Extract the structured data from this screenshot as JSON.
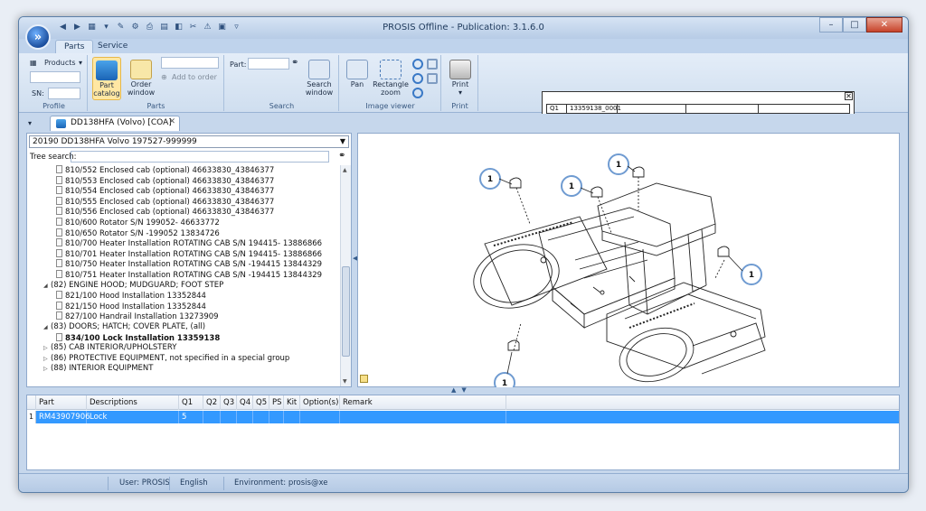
{
  "window": {
    "title": "PROSIS Offline - Publication: 3.1.6.0",
    "minimize": "–",
    "maximize": "□",
    "close": "✕"
  },
  "ribbon": {
    "tabs": [
      "Parts",
      "Service"
    ],
    "groups": {
      "profile": {
        "label": "Profile",
        "products": "Products",
        "sn_label": "SN:"
      },
      "parts": {
        "label": "Parts",
        "part_catalog": "Part catalog",
        "order_window": "Order window",
        "add_to_order": "Add to order"
      },
      "search": {
        "label": "Search",
        "part_label": "Part:",
        "search_window": "Search window"
      },
      "image_viewer": {
        "label": "Image viewer",
        "pan": "Pan",
        "rectangle_zoom": "Rectangle zoom"
      },
      "print": {
        "label": "Print",
        "print": "Print"
      }
    }
  },
  "pn_panel": {
    "col1": "Q1",
    "col2": "13359138_0001"
  },
  "doc_tab": {
    "label": "DD138HFA (Volvo) [COA]",
    "close": "✕"
  },
  "left_panel": {
    "model_select": "20190 DD138HFA Volvo 197527-999999",
    "tree_search_label": "Tree search:",
    "tree": [
      {
        "text": "810/552 Enclosed cab (optional) 46633830_43846377",
        "kind": "doc",
        "indent": 3
      },
      {
        "text": "810/553 Enclosed cab (optional) 46633830_43846377",
        "kind": "doc",
        "indent": 3
      },
      {
        "text": "810/554 Enclosed cab (optional) 46633830_43846377",
        "kind": "doc",
        "indent": 3
      },
      {
        "text": "810/555 Enclosed cab (optional) 46633830_43846377",
        "kind": "doc",
        "indent": 3
      },
      {
        "text": "810/556 Enclosed cab (optional) 46633830_43846377",
        "kind": "doc",
        "indent": 3
      },
      {
        "text": "810/600 Rotator S/N 199052- 46633772",
        "kind": "doc",
        "indent": 3
      },
      {
        "text": "810/650 Rotator S/N -199052 13834726",
        "kind": "doc",
        "indent": 3
      },
      {
        "text": "810/700 Heater Installation ROTATING CAB S/N 194415- 13886866",
        "kind": "doc",
        "indent": 3
      },
      {
        "text": "810/701 Heater Installation ROTATING CAB S/N 194415- 13886866",
        "kind": "doc",
        "indent": 3
      },
      {
        "text": "810/750 Heater Installation ROTATING CAB S/N -194415 13844329",
        "kind": "doc",
        "indent": 3
      },
      {
        "text": "810/751 Heater Installation ROTATING CAB S/N -194415 13844329",
        "kind": "doc",
        "indent": 3
      },
      {
        "text": "(82) ENGINE HOOD; MUDGUARD; FOOT  STEP",
        "kind": "open",
        "indent": 2
      },
      {
        "text": "821/100 Hood Installation 13352844",
        "kind": "doc",
        "indent": 3
      },
      {
        "text": "821/150 Hood Installation 13352844",
        "kind": "doc",
        "indent": 3
      },
      {
        "text": "827/100 Handrail Installation 13273909",
        "kind": "doc",
        "indent": 3
      },
      {
        "text": "(83) DOORS; HATCH; COVER PLATE,  (all)",
        "kind": "open",
        "indent": 2
      },
      {
        "text": "834/100 Lock Installation 13359138",
        "kind": "doc",
        "indent": 3,
        "selected": true
      },
      {
        "text": "(85) CAB INTERIOR/UPHOLSTERY",
        "kind": "closed",
        "indent": 2
      },
      {
        "text": "(86) PROTECTIVE EQUIPMENT, not  specified in a special group",
        "kind": "closed",
        "indent": 2
      },
      {
        "text": "(88) INTERIOR EQUIPMENT",
        "kind": "closed",
        "indent": 2
      }
    ]
  },
  "drawing": {
    "callouts": [
      "1",
      "1",
      "1",
      "1",
      "1"
    ]
  },
  "grid": {
    "columns": [
      "Part",
      "Descriptions",
      "Q1",
      "Q2",
      "Q3",
      "Q4",
      "Q5",
      "PS",
      "Kit",
      "Option(s)",
      "Remark"
    ],
    "rows": [
      {
        "num": "1",
        "part": "RM43907906",
        "description": "Lock",
        "q1": "5"
      }
    ]
  },
  "status": {
    "user": "User: PROSIS",
    "language": "English",
    "environment": "Environment: prosis@xe"
  },
  "colors": {
    "accent": "#3399ff",
    "frame": "#c6d7ec",
    "callout": "#6f9bd1"
  }
}
